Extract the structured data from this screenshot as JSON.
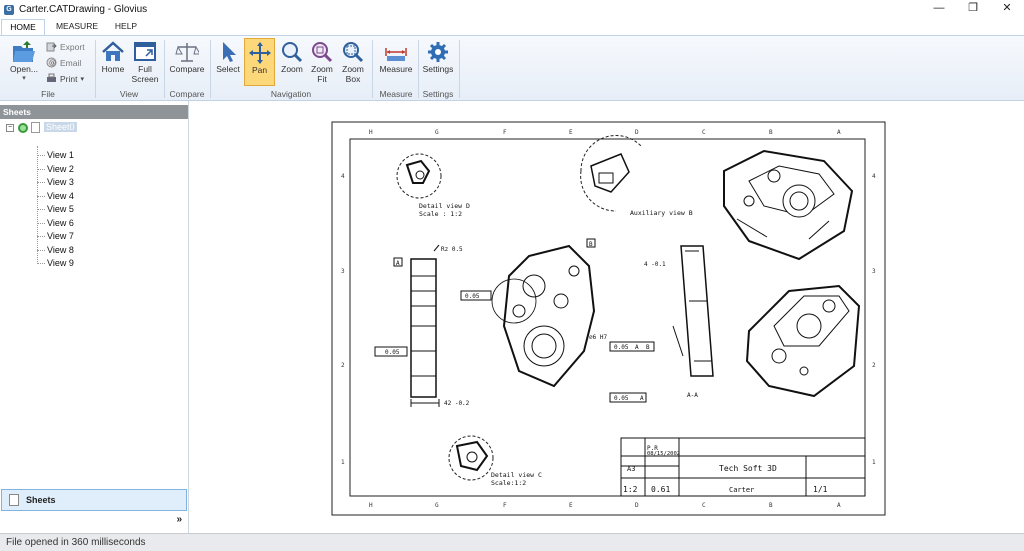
{
  "window": {
    "title": "Carter.CATDrawing - Glovius",
    "app_icon": "G",
    "controls": {
      "minimize": "—",
      "restore": "❐",
      "close": "✕"
    }
  },
  "tabs": [
    {
      "label": "HOME",
      "active": true
    },
    {
      "label": "MEASURE",
      "active": false
    },
    {
      "label": "HELP",
      "active": false
    }
  ],
  "ribbon": {
    "file": {
      "open": "Open...",
      "export": "Export",
      "email": "Email",
      "print": "Print",
      "group": "File"
    },
    "view": {
      "home": "Home",
      "full_screen_1": "Full",
      "full_screen_2": "Screen",
      "group": "View"
    },
    "compare": {
      "compare": "Compare",
      "group": "Compare"
    },
    "navigation": {
      "select": "Select",
      "pan": "Pan",
      "zoom": "Zoom",
      "zoom_fit_1": "Zoom",
      "zoom_fit_2": "Fit",
      "zoom_box_1": "Zoom",
      "zoom_box_2": "Box",
      "group": "Navigation"
    },
    "measure": {
      "measure": "Measure",
      "group": "Measure"
    },
    "settings": {
      "settings": "Settings",
      "group": "Settings"
    }
  },
  "sidebar": {
    "header": "Sheets",
    "root": "Sheet0",
    "views": [
      "View 1",
      "View 2",
      "View 3",
      "View 4",
      "View 5",
      "View 6",
      "View 7",
      "View 8",
      "View 9"
    ],
    "panel_button": "Sheets",
    "more": "»"
  },
  "drawing": {
    "border_letters": [
      "H",
      "G",
      "F",
      "E",
      "D",
      "C",
      "B",
      "A"
    ],
    "border_numbers": [
      "4",
      "3",
      "2",
      "1"
    ],
    "detail_d": "Detail view D",
    "detail_d_scale": "Scale :  1:2",
    "aux_b": "Auxiliary view B",
    "detail_c": "Detail view C",
    "detail_c_scale": "Scale:1:2",
    "section_aa": "A-A",
    "dim_42": "42 -0.2",
    "dim_4": "4 -0.1",
    "tol_1": "0.05",
    "tol_2": "0.05",
    "tol_3": "0.05",
    "tol_4": "0.05",
    "tol_ref_a": "A",
    "tol_ref_b": "B",
    "tol_ref_a2": "A",
    "datum_a": "A",
    "datum_b": "B",
    "rz": "Rz 0.5",
    "dim_m6": "⌀6 H7",
    "title_block": {
      "designed_by": "P.R",
      "date": "08/15/2002",
      "size": "A3",
      "company": "Tech Soft 3D",
      "scale": "1:2",
      "weight": "0.61",
      "name": "Carter",
      "sheet": "1/1"
    }
  },
  "status": {
    "text": "File opened in 360 milliseconds"
  }
}
